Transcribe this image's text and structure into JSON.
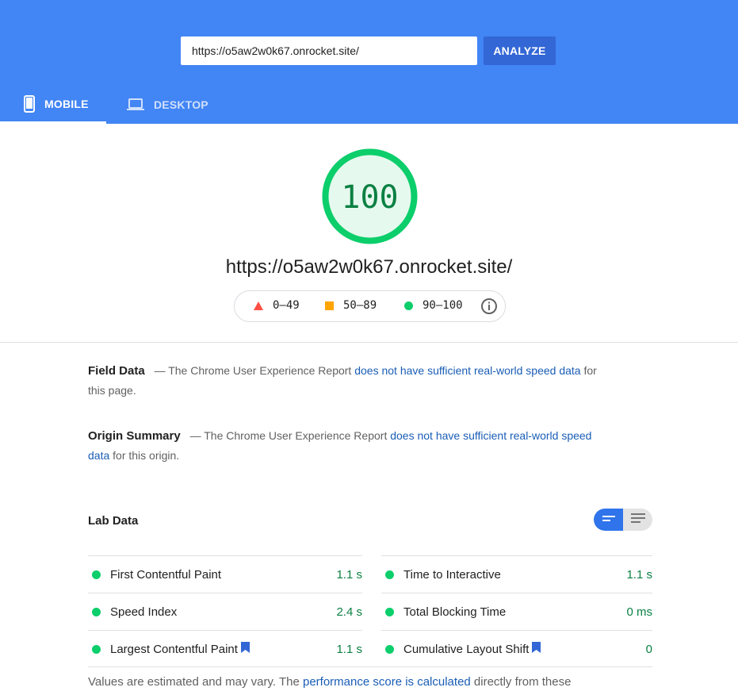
{
  "header": {
    "url_value": "https://o5aw2w0k67.onrocket.site/",
    "analyze_label": "ANALYZE",
    "tabs": [
      {
        "label": "MOBILE",
        "icon": "mobile-icon",
        "active": true
      },
      {
        "label": "DESKTOP",
        "icon": "desktop-icon",
        "active": false
      }
    ],
    "colors": {
      "header_bg": "#4285f4",
      "button_bg": "#3367d6"
    }
  },
  "score": {
    "value": "100",
    "fraction": 1.0,
    "url": "https://o5aw2w0k67.onrocket.site/",
    "color": "#0cce6b",
    "legend": {
      "low": "0–49",
      "mid": "50–89",
      "high": "90–100",
      "info_icon": "info-icon"
    }
  },
  "field_data": {
    "title": "Field Data",
    "dash": "—",
    "text_before": "The Chrome User Experience Report",
    "link": "does not have sufficient real-world speed data",
    "text_after": "for this page."
  },
  "origin_summary": {
    "title": "Origin Summary",
    "dash": "—",
    "text_before": "The Chrome User Experience Report",
    "link": "does not have sufficient real-world speed data",
    "text_after": "for this origin."
  },
  "lab_data": {
    "title": "Lab Data",
    "metrics": [
      {
        "name": "First Contentful Paint",
        "value": "1.1 s",
        "bookmark": false
      },
      {
        "name": "Time to Interactive",
        "value": "1.1 s",
        "bookmark": false
      },
      {
        "name": "Speed Index",
        "value": "2.4 s",
        "bookmark": false
      },
      {
        "name": "Total Blocking Time",
        "value": "0 ms",
        "bookmark": false
      },
      {
        "name": "Largest Contentful Paint",
        "value": "1.1 s",
        "bookmark": true
      },
      {
        "name": "Cumulative Layout Shift",
        "value": "0",
        "bookmark": true
      }
    ]
  },
  "footer": {
    "text_before": "Values are estimated and may vary. The",
    "link": "performance score is calculated",
    "text_after": "directly from these"
  }
}
